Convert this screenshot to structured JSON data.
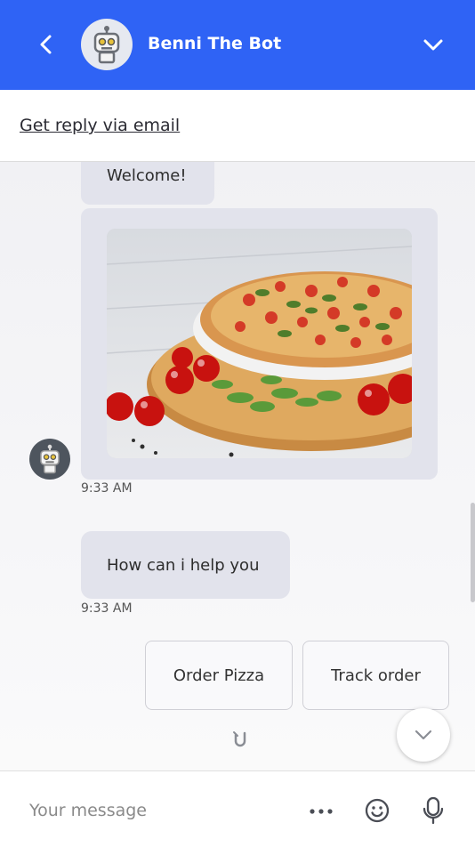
{
  "header": {
    "bot_name": "Benni The Bot",
    "color": "#2f63f5"
  },
  "email_bar": {
    "link_label": "Get reply via email"
  },
  "messages": [
    {
      "type": "text",
      "text": "Welcome!"
    },
    {
      "type": "image",
      "subject": "pizza-with-tomatoes",
      "time": "9:33 AM"
    },
    {
      "type": "text",
      "text": "How can i help you",
      "time": "9:33 AM"
    }
  ],
  "quick_replies": [
    {
      "label": "Order Pizza"
    },
    {
      "label": "Track order"
    }
  ],
  "composer": {
    "placeholder": "Your message",
    "icons": [
      "more-icon",
      "emoji-icon",
      "microphone-icon"
    ]
  },
  "icons": {
    "back": "chevron-left-icon",
    "collapse": "chevron-down-icon",
    "scroll_down": "chevron-down-icon",
    "typing": "magnet-icon"
  }
}
